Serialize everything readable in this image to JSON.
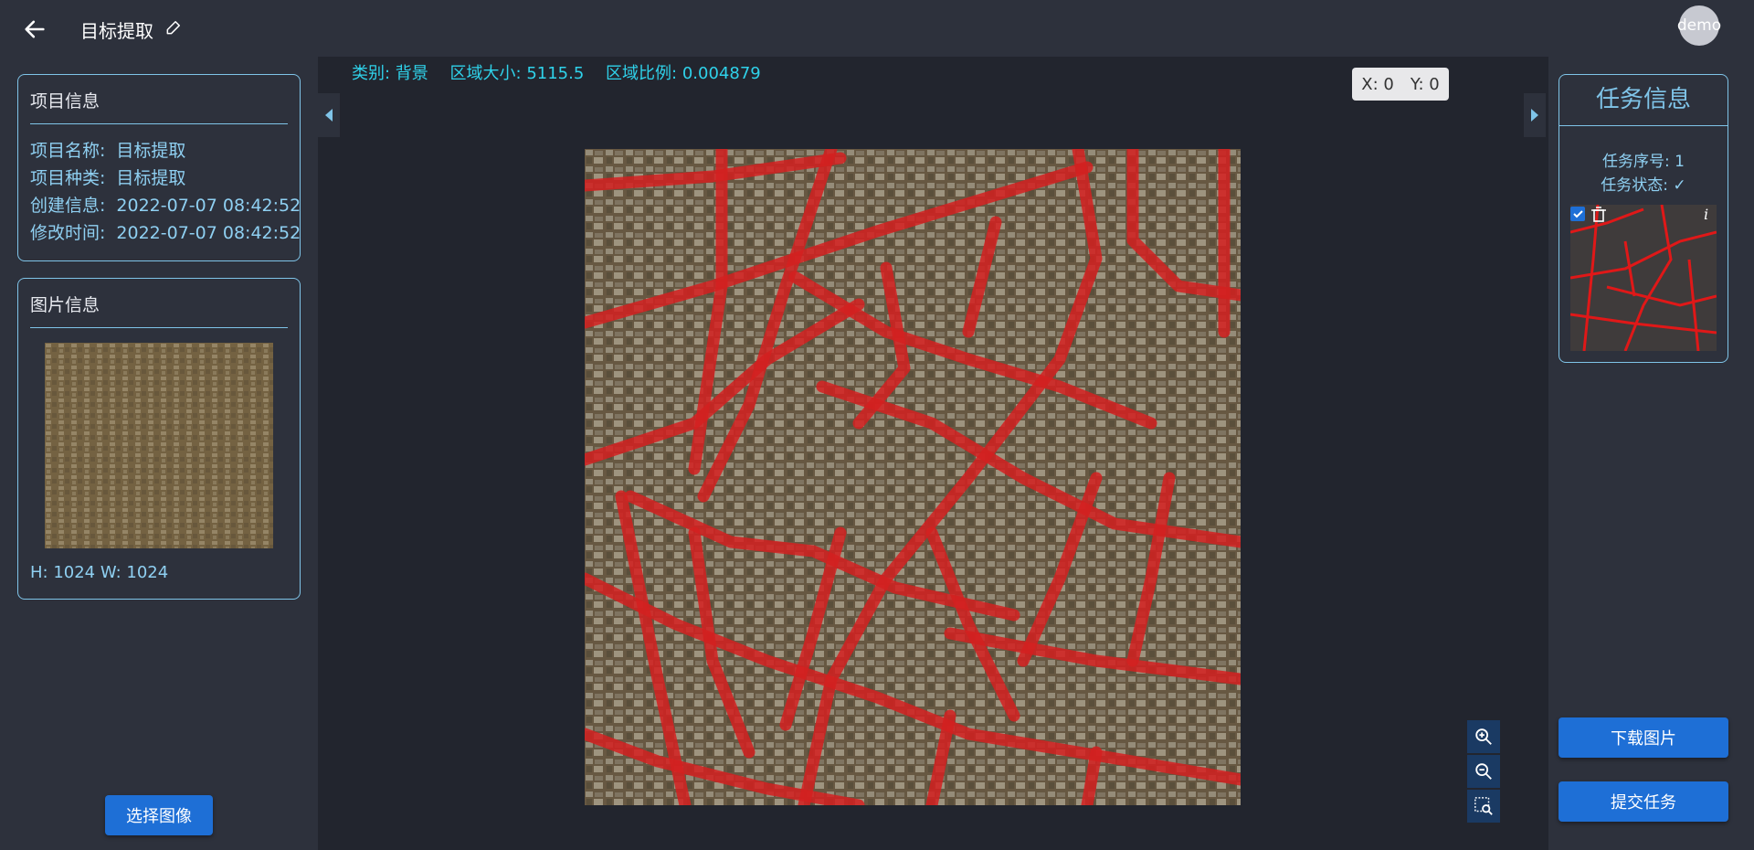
{
  "header": {
    "title": "目标提取",
    "avatar_text": "demo"
  },
  "project_info": {
    "title": "项目信息",
    "rows": [
      {
        "key": "项目名称:",
        "value": "目标提取"
      },
      {
        "key": "项目种类:",
        "value": "目标提取"
      },
      {
        "key": "创建信息:",
        "value": "2022-07-07 08:42:52"
      },
      {
        "key": "修改时间:",
        "value": "2022-07-07 08:42:52"
      }
    ]
  },
  "image_info": {
    "title": "图片信息",
    "size_text": "H: 1024  W: 1024",
    "select_button": "选择图像"
  },
  "stats": {
    "category": "类别: 背景",
    "area_size": "区域大小: 5115.5",
    "area_ratio": "区域比例: 0.004879"
  },
  "coords": {
    "x": "X: 0",
    "y": "Y: 0"
  },
  "task_info": {
    "title": "任务信息",
    "task_number": "任务序号: 1",
    "task_status": "任务状态: ✓",
    "download_button": "下载图片",
    "submit_button": "提交任务"
  },
  "colors": {
    "accent": "#7fc4e8",
    "stats_text": "#2fd2ea",
    "button": "#1e6fd6",
    "road_mask": "#d42020",
    "background": "#2d313c",
    "workspace": "#22252e"
  },
  "icons": [
    "back-arrow-icon",
    "edit-icon",
    "collapse-left-icon",
    "collapse-right-icon",
    "zoom-in-icon",
    "zoom-out-icon",
    "zoom-region-icon",
    "checkbox-icon",
    "trash-icon",
    "info-icon"
  ]
}
